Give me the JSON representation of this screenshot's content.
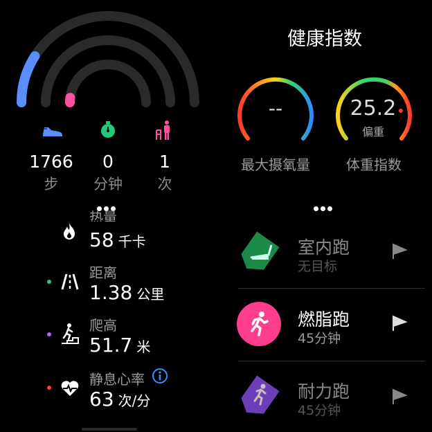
{
  "activity": {
    "rings": [
      {
        "name": "steps",
        "color": "#5b8dff",
        "progress": 0.18
      },
      {
        "name": "exercise",
        "color": "#22c97b",
        "progress": 0.0
      },
      {
        "name": "stand",
        "color": "#ff4fa0",
        "progress": 0.04
      }
    ],
    "stats": [
      {
        "icon": "shoe-icon",
        "value": "1766",
        "unit": "步",
        "color": "#5b8dff"
      },
      {
        "icon": "stopwatch-icon",
        "value": "0",
        "unit": "分钟",
        "color": "#22c97b"
      },
      {
        "icon": "stand-person-icon",
        "value": "1",
        "unit": "次",
        "color": "#ff4fa0"
      }
    ]
  },
  "metrics": [
    {
      "icon": "flame-icon",
      "label": "热量",
      "value": "58",
      "unit": "千卡",
      "dot_color": ""
    },
    {
      "icon": "road-icon",
      "label": "距离",
      "value": "1.38",
      "unit": "公里",
      "dot_color": "#22c97b"
    },
    {
      "icon": "climb-icon",
      "label": "爬高",
      "value": "51.7",
      "unit": "米",
      "dot_color": "#a66bff"
    },
    {
      "icon": "heart-pulse-icon",
      "label": "静息心率",
      "value": "63",
      "unit": "次/分",
      "dot_color": "#ff3b3b"
    }
  ],
  "health": {
    "title": "健康指数",
    "vo2max": {
      "label": "最大摄氧量",
      "value": "--"
    },
    "bmi": {
      "label": "体重指数",
      "value": "25.2",
      "status": "偏重",
      "position": 0.72
    }
  },
  "workouts": [
    {
      "name": "室内跑",
      "sub": "无目标",
      "icon": "treadmill-icon",
      "color": "#1b8a46",
      "active": false
    },
    {
      "name": "燃脂跑",
      "sub": "45分钟",
      "icon": "runner-icon",
      "color": "#ff3d8e",
      "active": true
    },
    {
      "name": "耐力跑",
      "sub": "45分钟",
      "icon": "runner-icon",
      "color": "#6a3fb8",
      "active": false
    }
  ]
}
